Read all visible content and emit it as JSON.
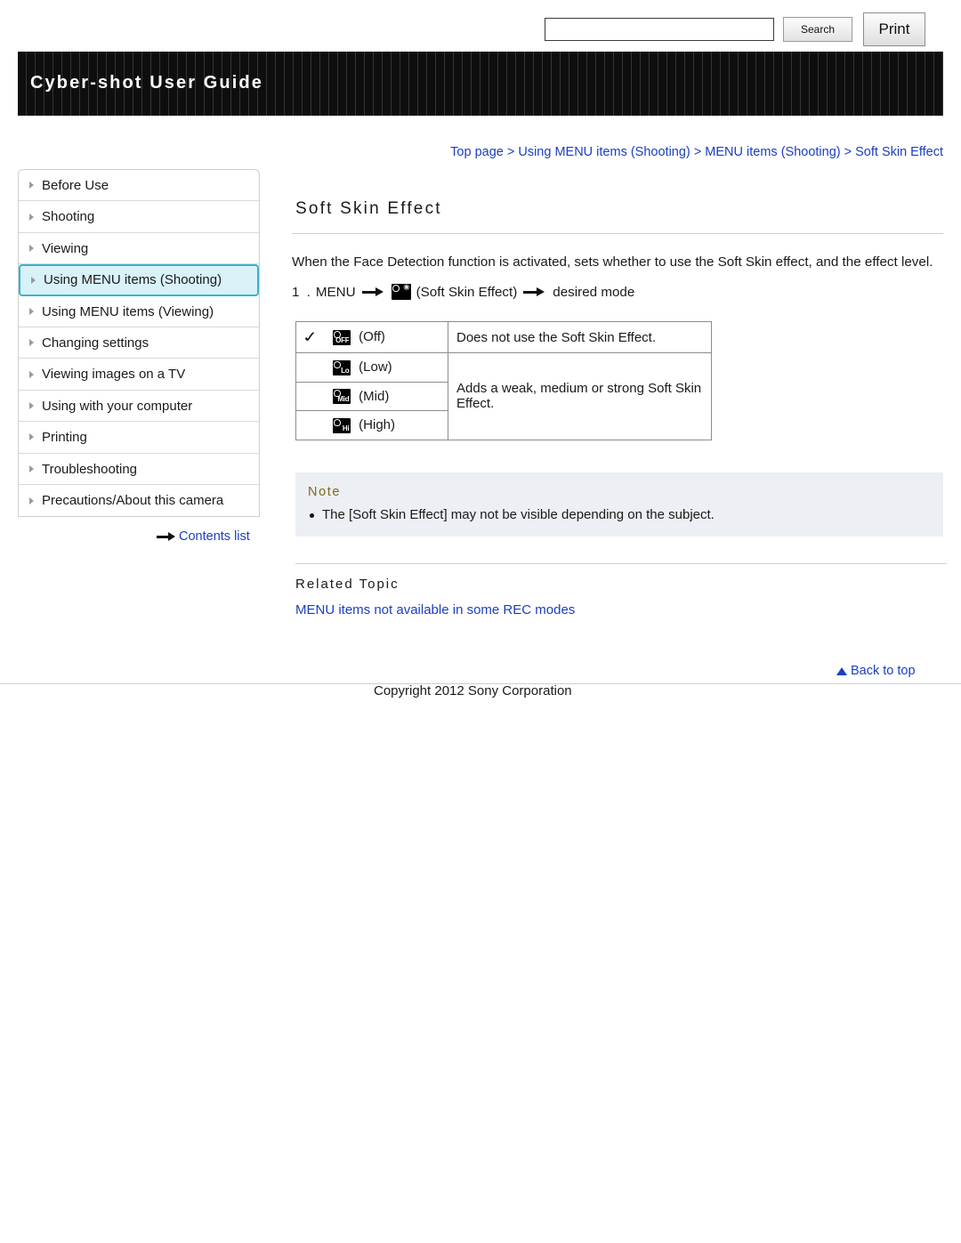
{
  "header": {
    "title": "Cyber-shot User Guide",
    "search_value": "",
    "search_placeholder": "",
    "search_label": "Search",
    "print_label": "Print"
  },
  "breadcrumb": {
    "items": [
      "Top page",
      "Using MENU items (Shooting)",
      "MENU items (Shooting)",
      "Soft Skin Effect"
    ],
    "separator": " > "
  },
  "sidebar": {
    "items": [
      {
        "label": "Before Use",
        "selected": false
      },
      {
        "label": "Shooting",
        "selected": false
      },
      {
        "label": "Viewing",
        "selected": false
      },
      {
        "label": "Using MENU items (Shooting)",
        "selected": true
      },
      {
        "label": "Using MENU items (Viewing)",
        "selected": false
      },
      {
        "label": "Changing settings",
        "selected": false
      },
      {
        "label": "Viewing images on a TV",
        "selected": false
      },
      {
        "label": "Using with your computer",
        "selected": false
      },
      {
        "label": "Printing",
        "selected": false
      },
      {
        "label": "Troubleshooting",
        "selected": false
      },
      {
        "label": "Precautions/About this camera",
        "selected": false
      }
    ],
    "contents_list": "Contents list"
  },
  "main": {
    "title": "Soft Skin Effect",
    "intro": "When the Face Detection function is activated, sets whether to use the Soft Skin effect, and the effect level.",
    "step": {
      "number": "1 .",
      "menu": "MENU",
      "icon_label": "menu-soft-skin-icon",
      "item": "(Soft Skin Effect)",
      "target": "desired mode"
    },
    "options": [
      {
        "icon": "OFF",
        "label": "(Off)",
        "checked": true,
        "description": "Does not use the Soft Skin Effect.",
        "desc_span": 1
      },
      {
        "icon": "Lo",
        "label": "(Low)",
        "checked": false,
        "description": "Adds a weak, medium or strong Soft Skin Effect.",
        "desc_span": 3
      },
      {
        "icon": "Mid",
        "label": "(Mid)",
        "checked": false,
        "description": "",
        "desc_span": 0
      },
      {
        "icon": "Hi",
        "label": "(High)",
        "checked": false,
        "description": "",
        "desc_span": 0
      }
    ],
    "note": {
      "title": "Note",
      "items": [
        "The [Soft Skin Effect] may not be visible depending on the subject."
      ]
    },
    "related": {
      "title": "Related Topic",
      "links": [
        "MENU items not available in some REC modes"
      ]
    }
  },
  "footer": {
    "back_to_top": "Back to top",
    "copyright": "Copyright 2012 Sony Corporation"
  }
}
